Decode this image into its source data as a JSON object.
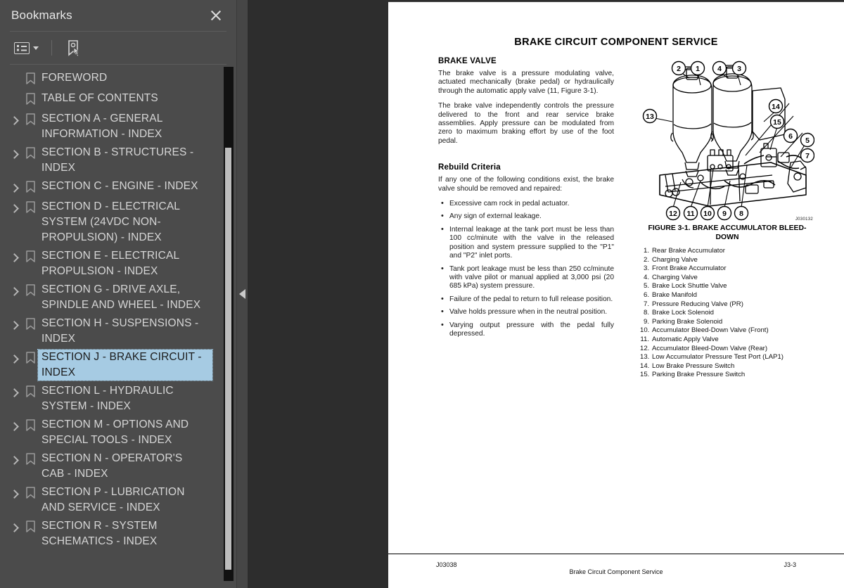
{
  "panel": {
    "title": "Bookmarks",
    "close_icon": "close-icon",
    "toolbar": {
      "list_options_icon": "list-options-icon",
      "caret_icon": "chevron-down-icon",
      "new_bookmark_icon": "bookmark-pointer-icon"
    },
    "items": [
      {
        "label": "FOREWORD",
        "expandable": false,
        "selected": false
      },
      {
        "label": "TABLE OF CONTENTS",
        "expandable": false,
        "selected": false
      },
      {
        "label": "SECTION A - GENERAL INFORMATION - INDEX",
        "expandable": true,
        "selected": false
      },
      {
        "label": "SECTION B - STRUCTURES - INDEX",
        "expandable": true,
        "selected": false
      },
      {
        "label": "SECTION C - ENGINE - INDEX",
        "expandable": true,
        "selected": false
      },
      {
        "label": "SECTION D - ELECTRICAL SYSTEM (24VDC NON-PROPULSION) - INDEX",
        "expandable": true,
        "selected": false
      },
      {
        "label": "SECTION E - ELECTRICAL PROPULSION - INDEX",
        "expandable": true,
        "selected": false
      },
      {
        "label": "SECTION G - DRIVE AXLE, SPINDLE AND WHEEL - INDEX",
        "expandable": true,
        "selected": false
      },
      {
        "label": "SECTION H - SUSPENSIONS - INDEX",
        "expandable": true,
        "selected": false
      },
      {
        "label": "SECTION J - BRAKE CIRCUIT - INDEX",
        "expandable": true,
        "selected": true
      },
      {
        "label": "SECTION L - HYDRAULIC SYSTEM - INDEX",
        "expandable": true,
        "selected": false
      },
      {
        "label": "SECTION M - OPTIONS AND SPECIAL TOOLS - INDEX",
        "expandable": true,
        "selected": false
      },
      {
        "label": "SECTION N - OPERATOR'S CAB - INDEX",
        "expandable": true,
        "selected": false
      },
      {
        "label": "SECTION P - LUBRICATION AND SERVICE - INDEX",
        "expandable": true,
        "selected": false
      },
      {
        "label": "SECTION R - SYSTEM SCHEMATICS - INDEX",
        "expandable": true,
        "selected": false
      }
    ]
  },
  "splitter": {
    "collapse_icon": "collapse-left-icon"
  },
  "document": {
    "title": "BRAKE CIRCUIT COMPONENT SERVICE",
    "section_heading": "BRAKE VALVE",
    "paragraphs": [
      "The brake valve is a pressure modulating valve, actuated mechanically (brake pedal) or hydraulically through the automatic apply valve (11, Figure 3-1).",
      "The brake valve independently controls the pressure delivered to the front and rear service brake assemblies. Apply pressure can be modulated from zero to maximum braking effort by use of the foot pedal."
    ],
    "rebuild_heading": "Rebuild Criteria",
    "rebuild_intro": "If any one of the following conditions exist, the brake valve should be removed and repaired:",
    "rebuild_bullets": [
      "Excessive cam rock in pedal actuator.",
      "Any sign of external leakage.",
      "Internal leakage at the tank port must be less than 100 cc/minute with the valve in the released position and system pressure supplied to the \"P1\" and \"P2\" inlet ports.",
      "Tank port leakage must be less than 250 cc/minute with valve pilot or manual applied at 3,000 psi (20 685 kPa) system pressure.",
      "Failure of the pedal to return to full release position.",
      "Valve holds pressure when in the neutral position.",
      "Varying output pressure with the pedal fully depressed."
    ],
    "figure": {
      "image_id": "J030132",
      "caption": "FIGURE 3-1. BRAKE ACCUMULATOR BLEED-DOWN",
      "callouts": [
        "1",
        "2",
        "3",
        "4",
        "5",
        "6",
        "7",
        "8",
        "9",
        "10",
        "11",
        "12",
        "13",
        "14",
        "15"
      ],
      "legend": [
        {
          "num": "1.",
          "text": "Rear Brake Accumulator"
        },
        {
          "num": "2.",
          "text": "Charging Valve"
        },
        {
          "num": "3.",
          "text": "Front Brake Accumulator"
        },
        {
          "num": "4.",
          "text": "Charging Valve"
        },
        {
          "num": "5.",
          "text": "Brake Lock Shuttle Valve"
        },
        {
          "num": "6.",
          "text": "Brake Manifold"
        },
        {
          "num": "7.",
          "text": "Pressure Reducing Valve (PR)"
        },
        {
          "num": "8.",
          "text": "Brake Lock Solenoid"
        },
        {
          "num": "9.",
          "text": "Parking Brake Solenoid"
        },
        {
          "num": "10.",
          "text": "Accumulator Bleed-Down Valve (Front)"
        },
        {
          "num": "11.",
          "text": "Automatic Apply Valve"
        },
        {
          "num": "12.",
          "text": "Accumulator Bleed-Down Valve (Rear)"
        },
        {
          "num": "13.",
          "text": "Low Accumulator Pressure Test Port (LAP1)"
        },
        {
          "num": "14.",
          "text": "Low Brake Pressure Switch"
        },
        {
          "num": "15.",
          "text": "Parking Brake Pressure Switch"
        }
      ]
    },
    "footer": {
      "left": "J03038",
      "center": "Brake Circuit Component Service",
      "right": "J3-3"
    }
  },
  "colors": {
    "panel_bg": "#4b4b4b",
    "viewer_bg": "#2d2d2d",
    "selection": "#a6cbe3",
    "page_bg": "#ffffff",
    "scrollbar_track": "#111111",
    "scrollbar_thumb": "#bdbdbd"
  }
}
